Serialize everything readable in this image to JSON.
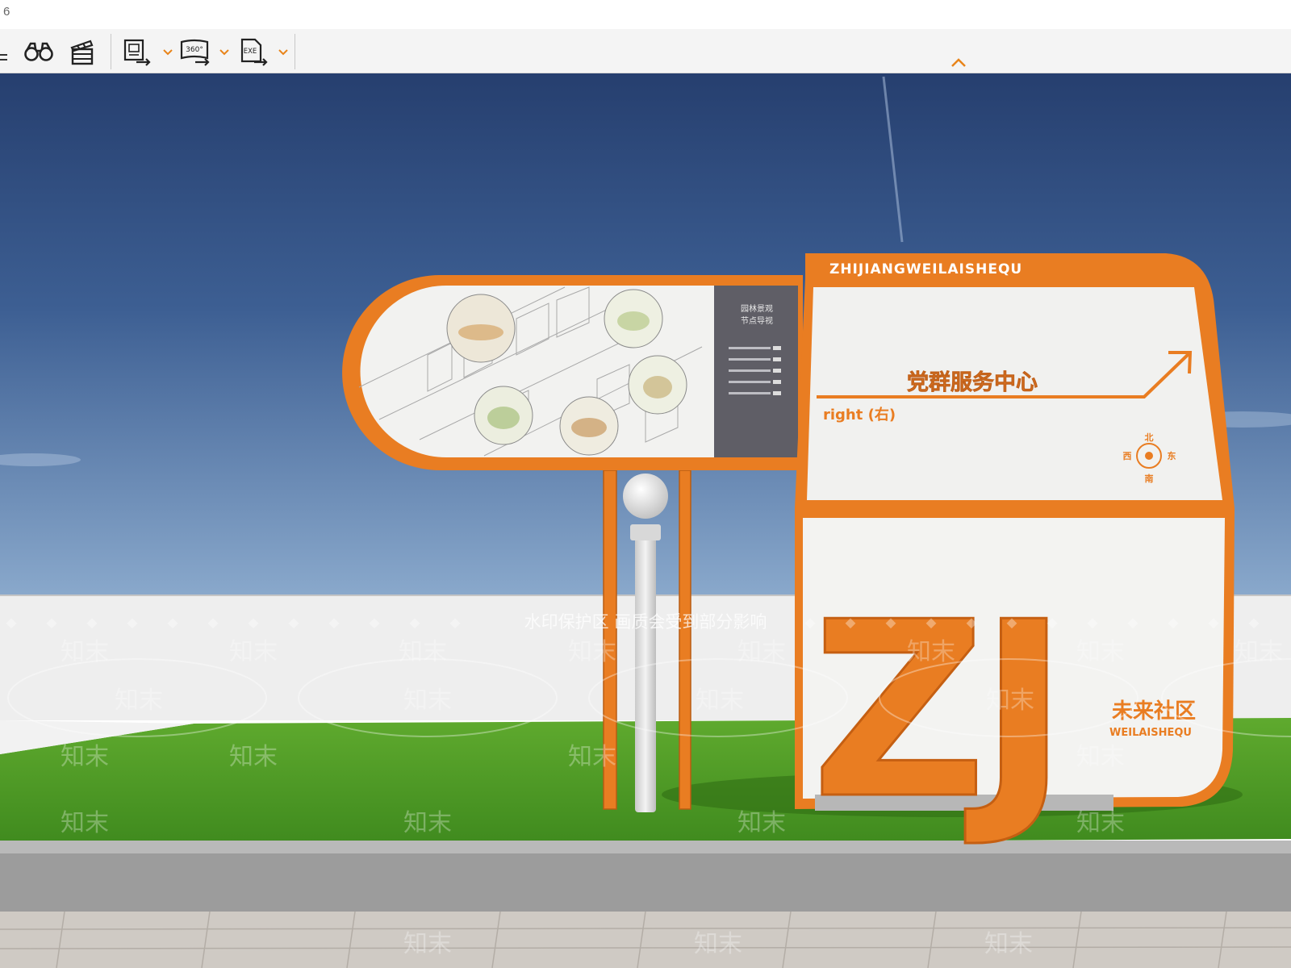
{
  "window": {
    "title_fragment": "6"
  },
  "toolbar": {
    "buttons": [
      {
        "icon": "binoculars-icon"
      },
      {
        "icon": "clapperboard-icon"
      },
      {
        "icon": "export-image-icon"
      },
      {
        "icon": "export-360-icon",
        "badge": "360°"
      },
      {
        "icon": "export-exe-icon",
        "badge": "EXE"
      }
    ],
    "accent": "#e8841a",
    "collapse_icon": "chevron-up-icon"
  },
  "scene": {
    "header_band": "ZHIJIANGWEILAISHEQU",
    "map_panel_title_1": "园林景观",
    "map_panel_title_2": "节点导视",
    "direction_label": "党群服务中心",
    "direction_sub": "right (右)",
    "compass": {
      "north": "北",
      "south": "南",
      "east": "东",
      "west": "西"
    },
    "logo_letters": "ZJ",
    "logo_cn": "未来社区",
    "logo_en": "WEILAISHEQU",
    "watermark_notice": "水印保护区   画质会受到部分影响",
    "watermark_mark": "知末",
    "colors": {
      "sign_orange": "#e97d22",
      "sky_top": "#2c4a7d",
      "sky_bottom": "#7a9fc6",
      "grass": "#4f9a26",
      "panel_grey": "#5f5e66"
    }
  }
}
